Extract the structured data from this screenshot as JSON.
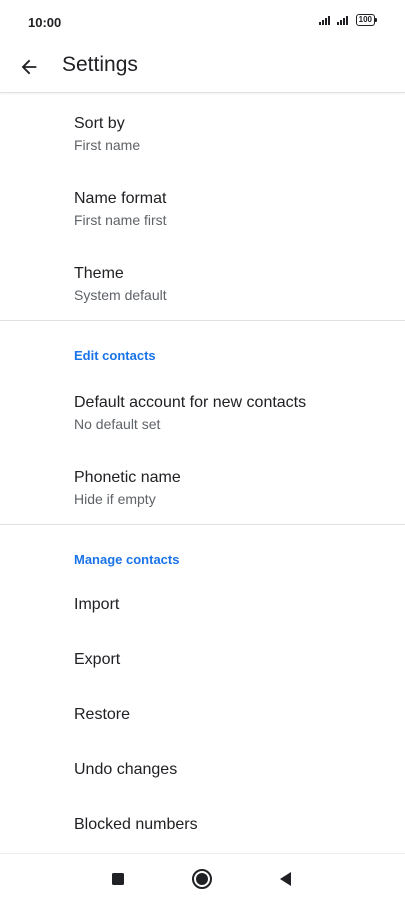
{
  "status_bar": {
    "time": "10:00",
    "battery": "100"
  },
  "app_bar": {
    "title": "Settings",
    "back_icon": "arrow-back-icon"
  },
  "general": {
    "sort_by": {
      "title": "Sort by",
      "value": "First name"
    },
    "name_format": {
      "title": "Name format",
      "value": "First name first"
    },
    "theme": {
      "title": "Theme",
      "value": "System default"
    }
  },
  "edit_contacts": {
    "header": "Edit contacts",
    "default_account": {
      "title": "Default account for new contacts",
      "value": "No default set"
    },
    "phonetic_name": {
      "title": "Phonetic name",
      "value": "Hide if empty"
    }
  },
  "manage_contacts": {
    "header": "Manage contacts",
    "import": "Import",
    "export": "Export",
    "restore": "Restore",
    "undo_changes": "Undo changes",
    "blocked_numbers": "Blocked numbers"
  },
  "nav_bar": {
    "recents_icon": "square-icon",
    "home_icon": "circle-icon",
    "back_icon": "triangle-back-icon"
  },
  "colors": {
    "accent": "#1a73e8",
    "text_primary": "#202124",
    "text_secondary": "#5f6368"
  }
}
